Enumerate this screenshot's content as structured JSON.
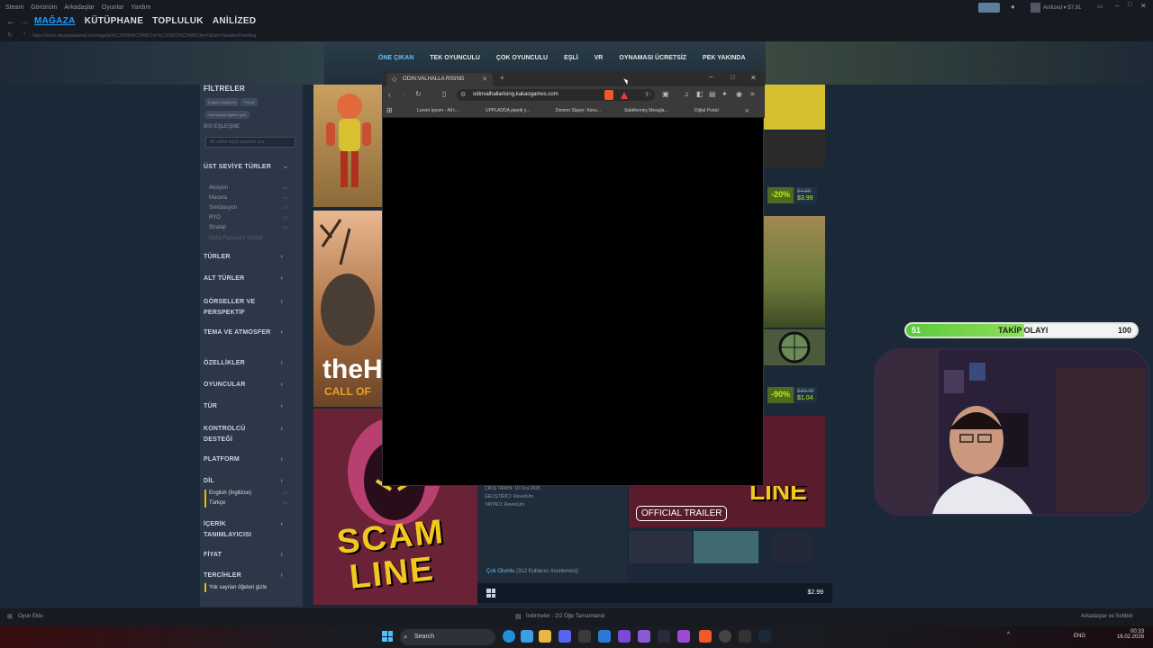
{
  "steam": {
    "top_menu": [
      "Steam",
      "Görünüm",
      "Arkadaşlar",
      "Oyunlar",
      "Yardım"
    ],
    "account": "Anilized",
    "balance": "$7.91",
    "nav": [
      "MAĞAZA",
      "KÜTÜPHANE",
      "TOPLULUK",
      "ANİLİZED"
    ],
    "url": "https://store.steampowered.com/tags/tr/%C3%96l%C3%BCmc%C3%BCl%C3%BC/#p=0&tab=NewAndTrending"
  },
  "store_tabs": [
    "ÖNE ÇIKAN",
    "TEK OYUNCULU",
    "ÇOK OYUNCULU",
    "EŞLİ",
    "VR",
    "OYNAMASI ÜCRETSİZ",
    "PEK YAKINDA"
  ],
  "filters": {
    "title": "FİLTRELER",
    "chips": [
      "English (İngilizce)",
      "Türkçe",
      "Yok sayılan öğeleri gizle"
    ],
    "match_count": "800 EŞLEŞME",
    "tag_placeholder": "Bir etiket veya seçenek ara",
    "top_genres_title": "ÜST SEVİYE TÜRLER",
    "genres": [
      {
        "name": "Aksiyon",
        "count": "589"
      },
      {
        "name": "Macera",
        "count": "401"
      },
      {
        "name": "Simülasyon",
        "count": "321"
      },
      {
        "name": "RYO",
        "count": "211"
      },
      {
        "name": "Strateji",
        "count": "204"
      }
    ],
    "show_more": "Daha Fazlasını Göster",
    "sections": [
      "TÜRLER",
      "ALT TÜRLER",
      "GÖRSELLER VE PERSPEKTİF",
      "TEMA VE ATMOSFER",
      "ÖZELLİKLER",
      "OYUNCULAR",
      "TÜR",
      "KONTROLCÜ DESTEĞİ",
      "PLATFORM"
    ],
    "language_title": "DİL",
    "languages": [
      {
        "name": "English (İngilizce)",
        "count": "800"
      },
      {
        "name": "Türkçe",
        "count": "800"
      }
    ],
    "content_title": "İÇERİK TANIMLAYICISI",
    "price_title": "FİYAT",
    "prefs_title": "TERCİHLER",
    "hide_ignored": "Yok sayılan öğeleri gizle"
  },
  "cards": {
    "price1": {
      "discount": "-20%",
      "old": "$4.99",
      "new": "$3.99"
    },
    "price2": {
      "discount": "-90%",
      "old": "$10.49",
      "new": "$1.04"
    },
    "hunter_text": "theH",
    "hunter_sub": "CALL OF",
    "scam_title_1": "SCAM",
    "scam_title_2": "LINE",
    "release": "ÇIKIŞ TARİHİ: 10 Oca 2026",
    "developer": "GELİŞTİRİCİ: RavenUm",
    "publisher": "YAYINCI: RavenUm",
    "trailer": "OFFICIAL TRAILER",
    "review": "Çok Olumlu",
    "review_detail": "(312 Kullanıcı İncelemesi)",
    "price3": "$2.99"
  },
  "browser": {
    "tab_title": "ODIN:VALHALLA RISING",
    "address": "odinvalhallarising.kakaogames.com",
    "bookmarks": [
      "Lorem Ipsum - All t...",
      "UPPLADDA pipetti y...",
      "Demon Slayer: Kimo...",
      "Sabitlenmiş Mesajla...",
      "Dijital Portal"
    ]
  },
  "follow": {
    "left": "51",
    "label": "TAKİP OLAYI",
    "right": "100",
    "progress": 0.51
  },
  "footer": {
    "add_game": "Oyun Ekle",
    "downloads": "İndirmeler - 2/2 Öğe Tamamlandı",
    "friends": "Arkadaşlar ve Sohbet"
  },
  "taskbar": {
    "search": "Search",
    "lang": "ENG",
    "time": "00:33",
    "date": "16.02.2026"
  }
}
